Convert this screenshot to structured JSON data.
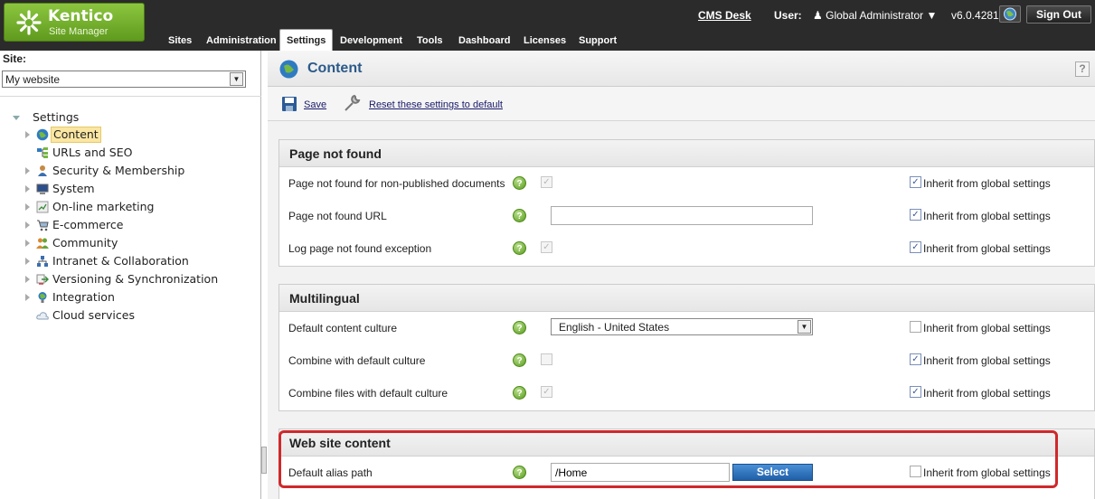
{
  "app": {
    "logo_title": "Kentico",
    "logo_subtitle": "Site Manager"
  },
  "top_nav": {
    "tabs": [
      {
        "label": "Sites"
      },
      {
        "label": "Administration"
      },
      {
        "label": "Settings",
        "active": true
      },
      {
        "label": "Development"
      },
      {
        "label": "Tools"
      },
      {
        "label": "Dashboard"
      },
      {
        "label": "Licenses"
      },
      {
        "label": "Support"
      }
    ],
    "cms_desk": "CMS Desk",
    "user_label": "User:",
    "user_name": "Global Administrator",
    "version": "v6.0.4281",
    "sign_out": "Sign Out"
  },
  "sidebar": {
    "site_label": "Site:",
    "site_value": "My website",
    "tree_root": "Settings",
    "items": [
      {
        "label": "Content",
        "icon": "globe-icon",
        "selected": true,
        "expandable": true
      },
      {
        "label": "URLs and SEO",
        "icon": "sitemap-icon",
        "expandable": false
      },
      {
        "label": "Security & Membership",
        "icon": "users-icon",
        "expandable": true
      },
      {
        "label": "System",
        "icon": "computer-icon",
        "expandable": true
      },
      {
        "label": "On-line marketing",
        "icon": "chart-icon",
        "expandable": true
      },
      {
        "label": "E-commerce",
        "icon": "cart-icon",
        "expandable": true
      },
      {
        "label": "Community",
        "icon": "group-icon",
        "expandable": true
      },
      {
        "label": "Intranet & Collaboration",
        "icon": "network-icon",
        "expandable": true
      },
      {
        "label": "Versioning & Synchronization",
        "icon": "sync-icon",
        "expandable": true
      },
      {
        "label": "Integration",
        "icon": "integration-icon",
        "expandable": true
      },
      {
        "label": "Cloud services",
        "icon": "cloud-icon",
        "expandable": false
      }
    ]
  },
  "main": {
    "title": "Content",
    "help": "?",
    "toolbar": {
      "save_label": "Save",
      "reset_label": "Reset these settings to default"
    },
    "inherit_label": "Inherit from global settings",
    "sections": {
      "page_not_found": {
        "title": "Page not found",
        "rows": [
          {
            "label": "Page not found for non-published documents",
            "control": "checkbox",
            "checked": true,
            "inherit": true
          },
          {
            "label": "Page not found URL",
            "control": "text",
            "value": "",
            "inherit": true
          },
          {
            "label": "Log page not found exception",
            "control": "checkbox",
            "checked": true,
            "inherit": true
          }
        ]
      },
      "multilingual": {
        "title": "Multilingual",
        "rows": [
          {
            "label": "Default content culture",
            "control": "select",
            "value": "English - United States",
            "inherit": false
          },
          {
            "label": "Combine with default culture",
            "control": "checkbox",
            "checked": false,
            "inherit": true
          },
          {
            "label": "Combine files with default culture",
            "control": "checkbox",
            "checked": true,
            "inherit": true
          }
        ]
      },
      "web_site_content": {
        "title": "Web site content",
        "rows": [
          {
            "label": "Default alias path",
            "control": "text-select",
            "value": "/Home",
            "button": "Select",
            "inherit": false
          }
        ]
      }
    }
  },
  "colors": {
    "header_bg": "#2b2b2b",
    "brand_green": "#6fae2a",
    "title_blue": "#2b5a8a",
    "select_button": "#2a6cb8",
    "highlight_red": "#d0282b"
  }
}
